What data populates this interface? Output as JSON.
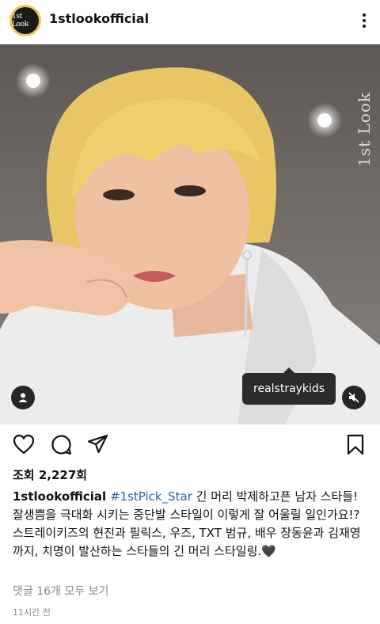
{
  "post": {
    "avatar_text": "1st Look",
    "username": "1stlookofficial",
    "watermark": "1st Look",
    "photo_tag": "realstraykids",
    "views": "조회 2,227회",
    "caption_user": "1stlookofficial",
    "caption_tag": "#1stPick_Star",
    "caption_text": "긴 머리 박제하고픈 남자 스타들! 잘생쁨을 극대화 시키는 중단발 스타일이 이렇게 잘 어울릴 일인가요!? 스트레이키즈의 현진과 필릭스, 우즈, TXT 범규, 배우 장동윤과 김재영까지, 치명이 발산하는 스타들의 긴 머리 스타일링.🖤",
    "comments_link": "댓글 16개 모두 보기",
    "time_ago": "11시간 전"
  },
  "icons": {
    "more": "more-vertical-icon",
    "like": "heart-icon",
    "comment": "comment-icon",
    "share": "paper-plane-icon",
    "save": "bookmark-icon",
    "tags": "user-tag-icon",
    "mute": "speaker-muted-icon"
  },
  "colors": {
    "hashtag": "#2c5eab",
    "muted_text": "#8a8a8a",
    "avatar_ring": "#f2c94c"
  }
}
